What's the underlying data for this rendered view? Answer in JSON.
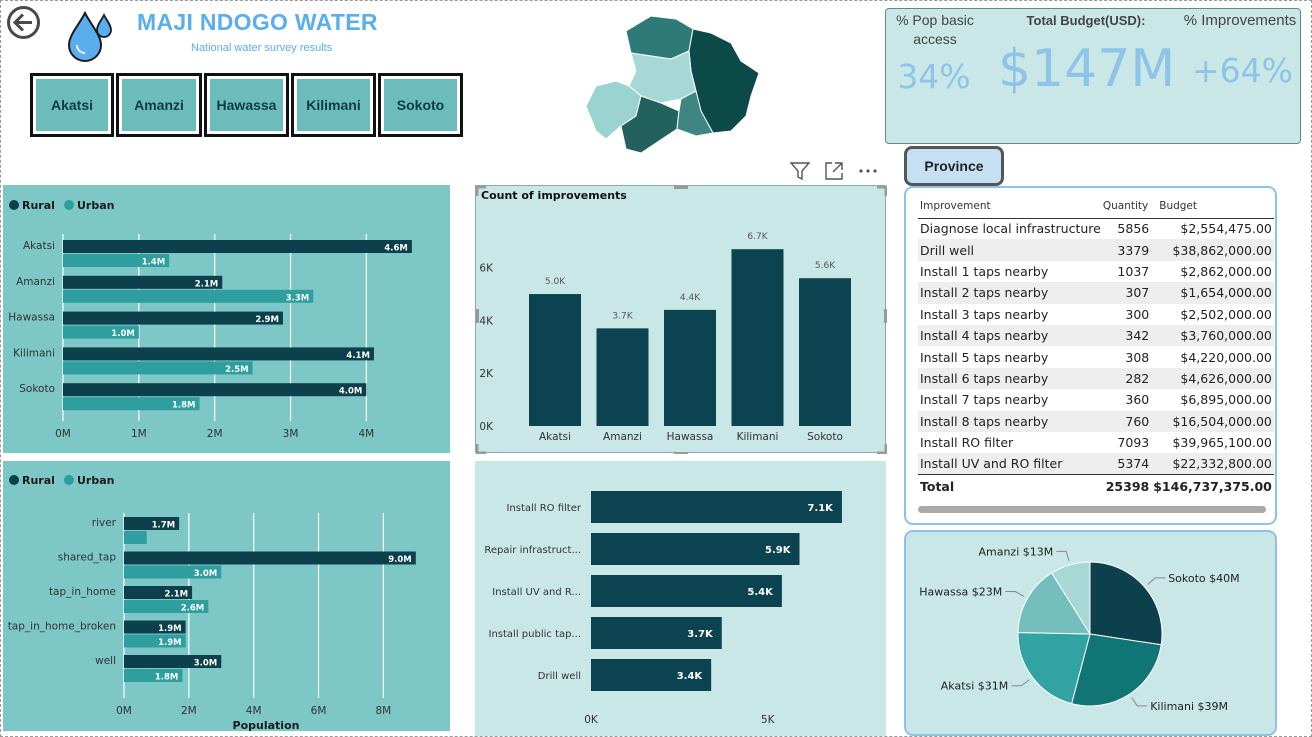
{
  "header": {
    "title": "MAJI NDOGO WATER",
    "subtitle": "National water survey results",
    "provinces": [
      "Akatsi",
      "Amanzi",
      "Hawassa",
      "Kilimani",
      "Sokoto"
    ]
  },
  "kpis": {
    "pop_basic_access_label": "% Pop basic access",
    "pop_basic_access_value": "34%",
    "total_budget_label": "Total Budget(USD):",
    "total_budget_value": "$147M",
    "improvements_label": "% Improvements",
    "improvements_value": "+64%"
  },
  "colors": {
    "rural": "#0c404c",
    "urban": "#2f9e9f",
    "bar_dark": "#0b4350",
    "teal_panel": "#7dc7c7",
    "light_panel": "#c9e7e6",
    "accent_blue": "#5aaeee",
    "pie": [
      "#0c404c",
      "#117575",
      "#32a3a3",
      "#74bfbd",
      "#a7d8d6"
    ]
  },
  "icons": {
    "back": "back-arrow-icon",
    "filter": "filter-icon",
    "focus": "focus-mode-icon",
    "more": "more-options-icon",
    "water": "water-drops-icon"
  },
  "slicer": {
    "label": "Province"
  },
  "improvements_table": {
    "headers": [
      "Improvement",
      "Quantity",
      "Budget"
    ],
    "rows": [
      [
        "Diagnose local infrastructure",
        "5856",
        "$2,554,475.00"
      ],
      [
        "Drill well",
        "3379",
        "$38,862,000.00"
      ],
      [
        "Install 1 taps nearby",
        "1037",
        "$2,862,000.00"
      ],
      [
        "Install 2 taps nearby",
        "307",
        "$1,654,000.00"
      ],
      [
        "Install 3 taps nearby",
        "300",
        "$2,502,000.00"
      ],
      [
        "Install 4 taps nearby",
        "342",
        "$3,760,000.00"
      ],
      [
        "Install 5 taps nearby",
        "308",
        "$4,220,000.00"
      ],
      [
        "Install 6 taps nearby",
        "282",
        "$4,626,000.00"
      ],
      [
        "Install 7 taps nearby",
        "360",
        "$6,895,000.00"
      ],
      [
        "Install 8 taps nearby",
        "760",
        "$16,504,000.00"
      ],
      [
        "Install RO filter",
        "7093",
        "$39,965,100.00"
      ],
      [
        "Install UV and RO filter",
        "5374",
        "$22,332,800.00"
      ]
    ],
    "total": [
      "Total",
      "25398",
      "$146,737,375.00"
    ]
  },
  "chart_data": [
    {
      "type": "bar",
      "orientation": "horizontal",
      "legend": "top-left",
      "categories": [
        "Akatsi",
        "Amanzi",
        "Hawassa",
        "Kilimani",
        "Sokoto"
      ],
      "series": [
        {
          "name": "Rural",
          "values": [
            4.6,
            2.1,
            2.9,
            4.1,
            4.0
          ],
          "labels": [
            "4.6M",
            "2.1M",
            "2.9M",
            "4.1M",
            "4.0M"
          ]
        },
        {
          "name": "Urban",
          "values": [
            1.4,
            3.3,
            1.0,
            2.5,
            1.8
          ],
          "labels": [
            "1.4M",
            "3.3M",
            "1.0M",
            "2.5M",
            "1.8M"
          ]
        }
      ],
      "xticks": [
        "0M",
        "1M",
        "2M",
        "3M",
        "4M"
      ],
      "xlim": [
        0,
        5.05
      ],
      "grid": true
    },
    {
      "type": "bar",
      "title": "Count of improvements",
      "categories": [
        "Akatsi",
        "Amanzi",
        "Hawassa",
        "Kilimani",
        "Sokoto"
      ],
      "values": [
        5000,
        3700,
        4400,
        6700,
        5600
      ],
      "labels": [
        "5.0K",
        "3.7K",
        "4.4K",
        "6.7K",
        "5.6K"
      ],
      "yticks": [
        "0K",
        "2K",
        "4K",
        "6K"
      ],
      "ylim": [
        0,
        7200
      ],
      "grid": false
    },
    {
      "type": "bar",
      "orientation": "horizontal",
      "legend": "top-left",
      "xlabel": "Population",
      "categories": [
        "river",
        "shared_tap",
        "tap_in_home",
        "tap_in_home_broken",
        "well"
      ],
      "series": [
        {
          "name": "Rural",
          "values": [
            1.7,
            9.0,
            2.1,
            1.9,
            3.0
          ],
          "labels": [
            "1.7M",
            "9.0M",
            "2.1M",
            "1.9M",
            "3.0M"
          ]
        },
        {
          "name": "Urban",
          "values": [
            0.7,
            3.0,
            2.6,
            1.9,
            1.8
          ],
          "labels": [
            "",
            "3.0M",
            "2.6M",
            "1.9M",
            "1.8M"
          ]
        }
      ],
      "xticks": [
        "0M",
        "2M",
        "4M",
        "6M",
        "8M"
      ],
      "xlim": [
        0,
        9.5
      ],
      "grid": true
    },
    {
      "type": "bar",
      "orientation": "horizontal",
      "categories": [
        "Install RO filter",
        "Repair infrastruct...",
        "Install UV and R...",
        "Install public tap...",
        "Drill well"
      ],
      "values": [
        7100,
        5900,
        5400,
        3700,
        3400
      ],
      "labels": [
        "7.1K",
        "5.9K",
        "5.4K",
        "3.7K",
        "3.4K"
      ],
      "xticks": [
        "0K",
        "5K"
      ],
      "xlim": [
        0,
        8800
      ],
      "grid": false
    },
    {
      "type": "pie",
      "categories": [
        "Sokoto",
        "Kilimani",
        "Akatsi",
        "Hawassa",
        "Amanzi"
      ],
      "values": [
        40,
        39,
        31,
        23,
        13
      ],
      "labels": [
        "Sokoto $40M",
        "Kilimani $39M",
        "Akatsi $31M",
        "Hawassa $23M",
        "Amanzi $13M"
      ]
    }
  ]
}
